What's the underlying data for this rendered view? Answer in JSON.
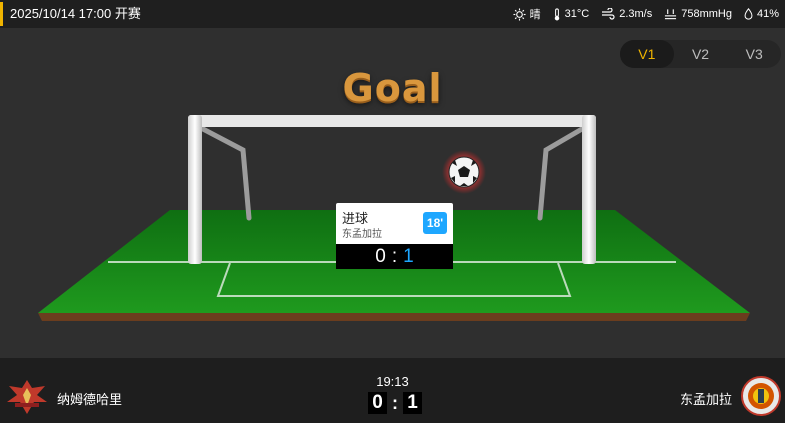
{
  "match": {
    "datetime": "2025/10/14 17:00",
    "status": "开赛"
  },
  "weather": {
    "condition": "晴",
    "temperature": "31°C",
    "wind": "2.3m/s",
    "pressure": "758mmHg",
    "humidity": "41%"
  },
  "views": {
    "tabs": [
      "V1",
      "V2",
      "V3"
    ],
    "active": "V1"
  },
  "event": {
    "title": "Goal",
    "type": "进球",
    "team": "东孟加拉",
    "minute": "18'",
    "home_score": "0",
    "away_score": "1"
  },
  "scoreboard": {
    "clock": "19:13",
    "home_team": "纳姆德哈里",
    "away_team": "东孟加拉",
    "home_score": "0",
    "away_score": "1",
    "separator": ":"
  },
  "colors": {
    "accent": "#f0b400",
    "away_highlight": "#1ea7ff",
    "pitch": "#1f8f1f"
  },
  "icons": [
    "sun-icon",
    "thermometer-icon",
    "wind-icon",
    "pressure-icon",
    "humidity-icon",
    "football-icon"
  ]
}
